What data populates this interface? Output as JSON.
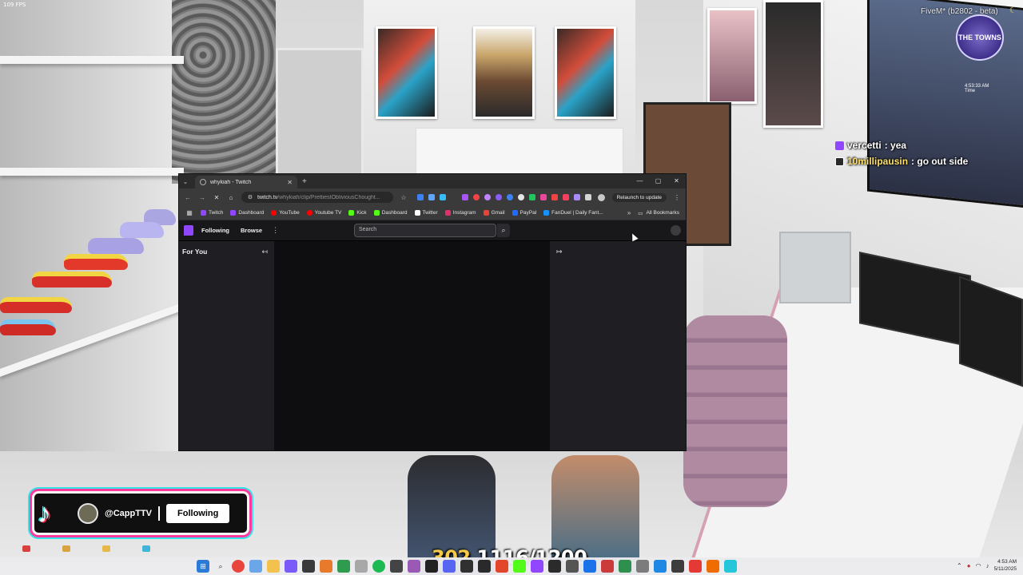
{
  "overlay": {
    "fps": "109 FPS",
    "fivem": "FiveM* (b2802 - beta)",
    "towns_logo": "THE TOWNS",
    "mini_clock": "4:53:33 AM",
    "mini_clock_label": "Time",
    "chat": [
      {
        "user": "vercetti",
        "message": ": yea"
      },
      {
        "user": "10millipausin",
        "message": ": go out side"
      }
    ],
    "tiktok": {
      "handle": "@CappTTV",
      "follow_label": "Following"
    },
    "counter": {
      "left": "302",
      "right": "1116/1200"
    }
  },
  "browser": {
    "tab_title": "whykiah - Twitch",
    "url_main": "twitch.tv",
    "url_path": "/whykiah/clip/PrettiestObliviousChought...",
    "relaunch_label": "Relaunch to update",
    "bookmarks": [
      {
        "label": "Twitch",
        "color": "#9146ff"
      },
      {
        "label": "Dashboard",
        "color": "#9146ff"
      },
      {
        "label": "YouTube",
        "color": "#ff0000"
      },
      {
        "label": "Youtube TV",
        "color": "#ff0000"
      },
      {
        "label": "Kick",
        "color": "#53fc18"
      },
      {
        "label": "Dashboard",
        "color": "#53fc18"
      },
      {
        "label": "Twitter",
        "color": "#ffffff"
      },
      {
        "label": "Instagram",
        "color": "#e1306c"
      },
      {
        "label": "Gmail",
        "color": "#ea4335"
      },
      {
        "label": "PayPal",
        "color": "#1f6bff"
      },
      {
        "label": "FanDuel | Daily Fant...",
        "color": "#1493ff"
      }
    ],
    "all_bookmarks": "All Bookmarks"
  },
  "twitch": {
    "nav_following": "Following",
    "nav_browse": "Browse",
    "search_placeholder": "Search",
    "sidebar_title": "For You"
  },
  "taskbar": {
    "time": "4:53 AM",
    "date": "5/11/2025"
  }
}
